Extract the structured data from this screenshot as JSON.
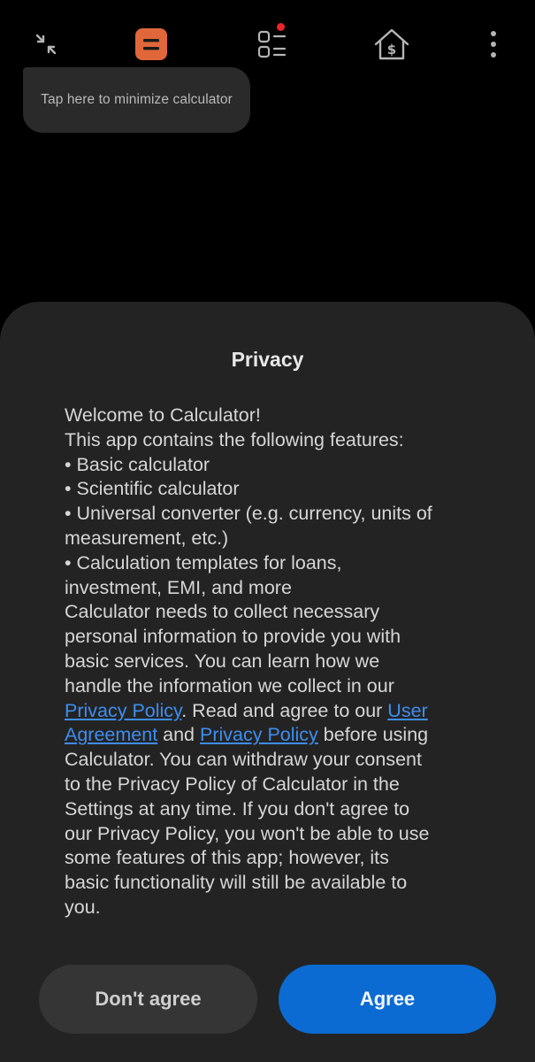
{
  "toolbar": {
    "icons": [
      "minimize-icon",
      "calculator-icon",
      "converter-icon",
      "finance-home-icon",
      "more-options-icon"
    ],
    "colors": {
      "calculator_accent": "#e0673a",
      "badge": "#e8262b"
    }
  },
  "tooltip": {
    "text": "Tap here to minimize calculator"
  },
  "dialog": {
    "title": "Privacy",
    "body": {
      "l1": "Welcome to Calculator!",
      "l2": "This app contains the following features:",
      "l3": "• Basic calculator",
      "l4": "• Scientific calculator",
      "l5": "• Universal converter (e.g. currency, units of",
      "l6": "measurement, etc.)",
      "l7": "• Calculation templates for loans,",
      "l8": "investment, EMI, and more",
      "l9": "Calculator needs to collect necessary",
      "l10": "personal information to provide you with",
      "l11": "basic services. You can learn how we",
      "l12": "handle the information we collect in our",
      "l13_link": "Privacy Policy",
      "l13_text": ". Read and agree to our ",
      "l13_link2": "User",
      "l14_link": "Agreement",
      "l14_text": " and ",
      "l14_link2": "Privacy Policy",
      "l14_text2": " before using",
      "l15": "Calculator. You can withdraw your consent",
      "l16": "to the Privacy Policy of Calculator in the",
      "l17": "Settings at any time. If you don't agree to",
      "l18": "our Privacy Policy, you won't be able to use",
      "l19": "some features of this app; however, its",
      "l20": "basic functionality will still be available to",
      "l21": "you."
    },
    "disagree_label": "Don't agree",
    "agree_label": "Agree",
    "colors": {
      "link": "#3e8ef0",
      "agree_button": "#0b6bd3"
    }
  }
}
